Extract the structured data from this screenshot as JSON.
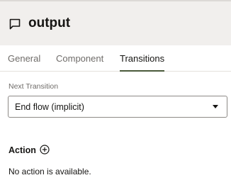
{
  "header": {
    "icon": "comment-icon",
    "title": "output"
  },
  "tabs": [
    {
      "label": "General",
      "active": false
    },
    {
      "label": "Component",
      "active": false
    },
    {
      "label": "Transitions",
      "active": true
    }
  ],
  "next_transition": {
    "label": "Next Transition",
    "value": "End flow (implicit)"
  },
  "action": {
    "title": "Action",
    "add_icon": "add-circle-icon",
    "empty_text": "No action is available."
  },
  "colors": {
    "header_bg": "#f1efed",
    "active_tab_underline": "#4a5a3a",
    "text": "#161513",
    "muted_text": "#6f6c69"
  }
}
